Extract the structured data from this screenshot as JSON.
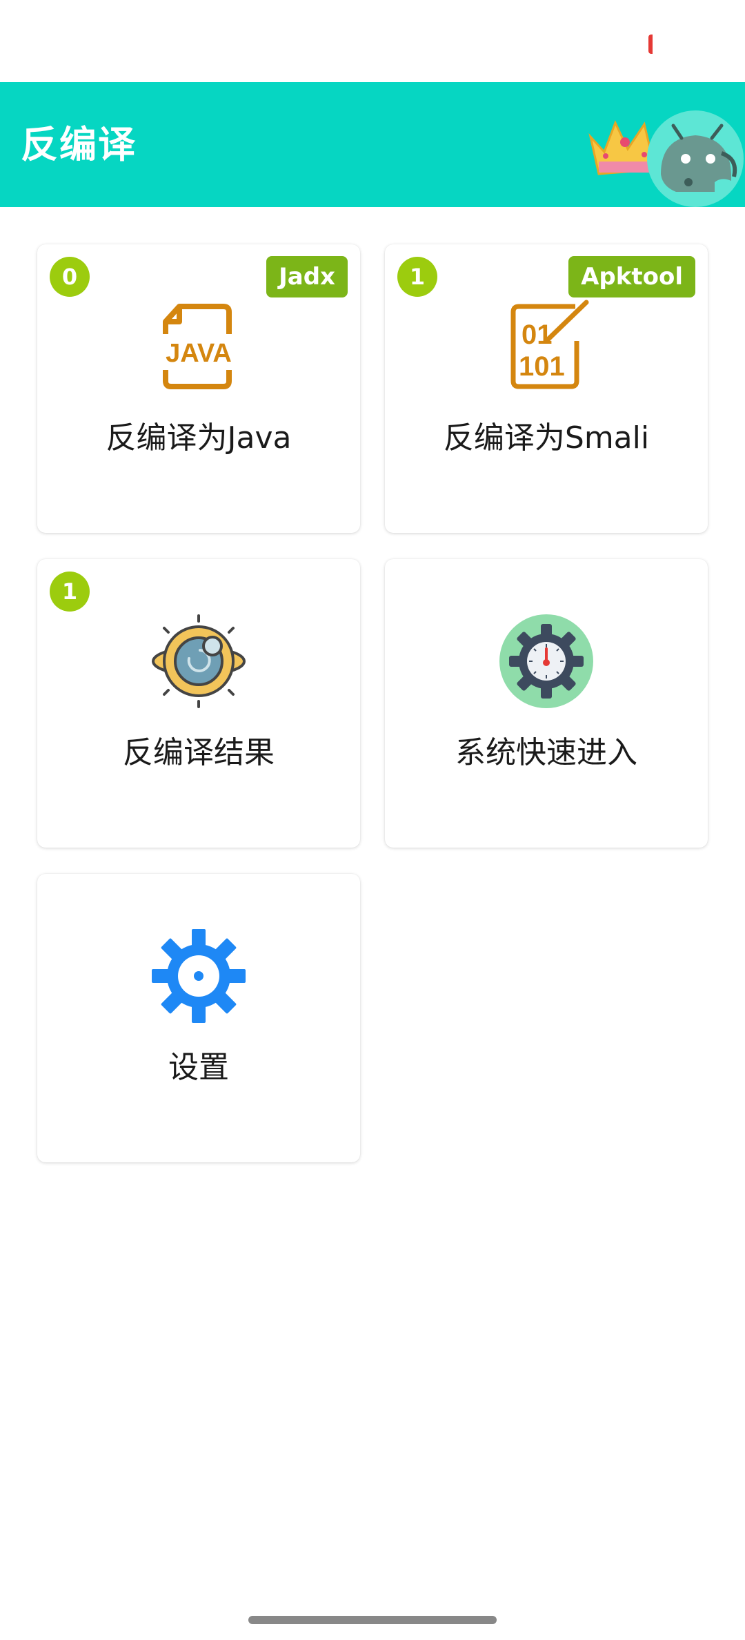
{
  "app_bar": {
    "title": "反编译"
  },
  "cards": [
    {
      "label": "反编译为Java",
      "count": "0",
      "tag": "Jadx",
      "icon": "java-file-icon"
    },
    {
      "label": "反编译为Smali",
      "count": "1",
      "tag": "Apktool",
      "icon": "binary-file-icon"
    },
    {
      "label": "反编译结果",
      "count": "1",
      "icon": "decompile-result-icon"
    },
    {
      "label": "系统快速进入",
      "icon": "system-speedometer-gear-icon"
    },
    {
      "label": "设置",
      "icon": "settings-gear-icon"
    }
  ],
  "colors": {
    "app_bar": "#06d6c2",
    "count_badge": "#9ccc0e",
    "tag_badge": "#7cb518",
    "java_icon": "#d4860f",
    "settings_icon": "#1e88f5",
    "system_icon_bg": "#8fdcaa"
  }
}
